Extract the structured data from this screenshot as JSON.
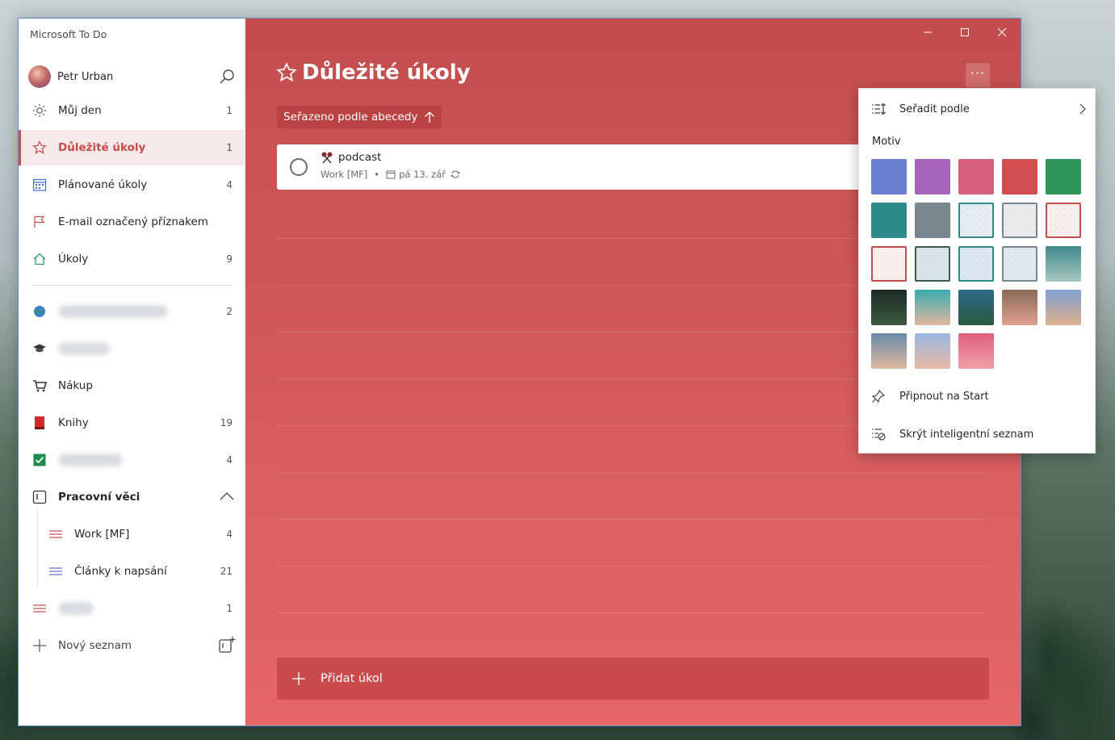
{
  "app": {
    "title": "Microsoft To Do"
  },
  "user": {
    "name": "Petr Urban"
  },
  "sidebar": {
    "smart_lists": [
      {
        "label": "Můj den",
        "count": "1",
        "icon": "sun-icon"
      },
      {
        "label": "Důležité úkoly",
        "count": "1",
        "icon": "star-icon",
        "active": true
      },
      {
        "label": "Plánované úkoly",
        "count": "4",
        "icon": "calendar-icon"
      },
      {
        "label": "E-mail označený příznakem",
        "count": "",
        "icon": "flag-icon"
      },
      {
        "label": "Úkoly",
        "count": "9",
        "icon": "home-icon"
      }
    ],
    "lists": [
      {
        "label": "",
        "count": "2",
        "icon": "globe-icon",
        "blurred": true
      },
      {
        "label": "",
        "count": "",
        "icon": "graduation-cap-icon",
        "blurred": true
      },
      {
        "label": "Nákup",
        "count": "",
        "icon": "shopping-cart-icon"
      },
      {
        "label": "Knihy",
        "count": "19",
        "icon": "book-icon"
      },
      {
        "label": "",
        "count": "4",
        "icon": "check-box-icon",
        "blurred": true
      }
    ],
    "group": {
      "label": "Pracovní věci",
      "items": [
        {
          "label": "Work [MF]",
          "count": "4"
        },
        {
          "label": "Články k napsání",
          "count": "21"
        }
      ]
    },
    "bottom_list": {
      "label": "",
      "count": "1",
      "blurred": true
    },
    "new_list_label": "Nový seznam"
  },
  "main": {
    "title": "Důležité úkoly",
    "more_label": "···",
    "sort_label": "Seřazeno podle abecedy",
    "task": {
      "title": "podcast",
      "list": "Work [MF]",
      "due": "pá 13. zář"
    },
    "add_task_label": "Přidat úkol"
  },
  "menu": {
    "sort_by_label": "Seřadit podle",
    "theme_label": "Motiv",
    "pin_label": "Připnout na Start",
    "hide_label": "Skrýt inteligentní seznam",
    "themes": [
      {
        "type": "color",
        "color": "#6b7fd1"
      },
      {
        "type": "color",
        "color": "#a665b8"
      },
      {
        "type": "color",
        "color": "#d9607a"
      },
      {
        "type": "color",
        "color": "#d24f4f",
        "selected": true
      },
      {
        "type": "color",
        "color": "#30965a"
      },
      {
        "type": "color",
        "color": "#2f8a8a"
      },
      {
        "type": "color",
        "color": "#78868f"
      },
      {
        "type": "pattern",
        "color": "#e6edf4",
        "border": "#2f8a8a"
      },
      {
        "type": "pattern",
        "color": "#ececef",
        "border": "#78868f"
      },
      {
        "type": "pattern",
        "color": "#faf0ee",
        "border": "#c34d4d"
      },
      {
        "type": "pattern",
        "color": "#fbf1ef",
        "border": "#c34d4d"
      },
      {
        "type": "pattern",
        "color": "#dbe6ec",
        "border": "#3d5a4a"
      },
      {
        "type": "pattern",
        "color": "#dfe9f1",
        "border": "#2f8a8a"
      },
      {
        "type": "pattern",
        "color": "#e3e9f1",
        "border": "#78868f"
      },
      {
        "type": "photo",
        "color": "#3f8a8a",
        "color2": "#a8c8c0"
      },
      {
        "type": "photo",
        "color": "#1b2a22",
        "color2": "#3c5a40"
      },
      {
        "type": "photo",
        "color": "#3aa8b0",
        "color2": "#e0b8a0"
      },
      {
        "type": "photo",
        "color": "#2f6a8a",
        "color2": "#2a5a40"
      },
      {
        "type": "photo",
        "color": "#8a6a5a",
        "color2": "#e0a090"
      },
      {
        "type": "photo",
        "color": "#7fa0d0",
        "color2": "#e0b090"
      },
      {
        "type": "photo",
        "color": "#6a8aa8",
        "color2": "#e0b8a0"
      },
      {
        "type": "photo",
        "color": "#9ab8e0",
        "color2": "#e8b8a8"
      },
      {
        "type": "photo",
        "color": "#e0607a",
        "color2": "#f0a0a8"
      }
    ]
  }
}
